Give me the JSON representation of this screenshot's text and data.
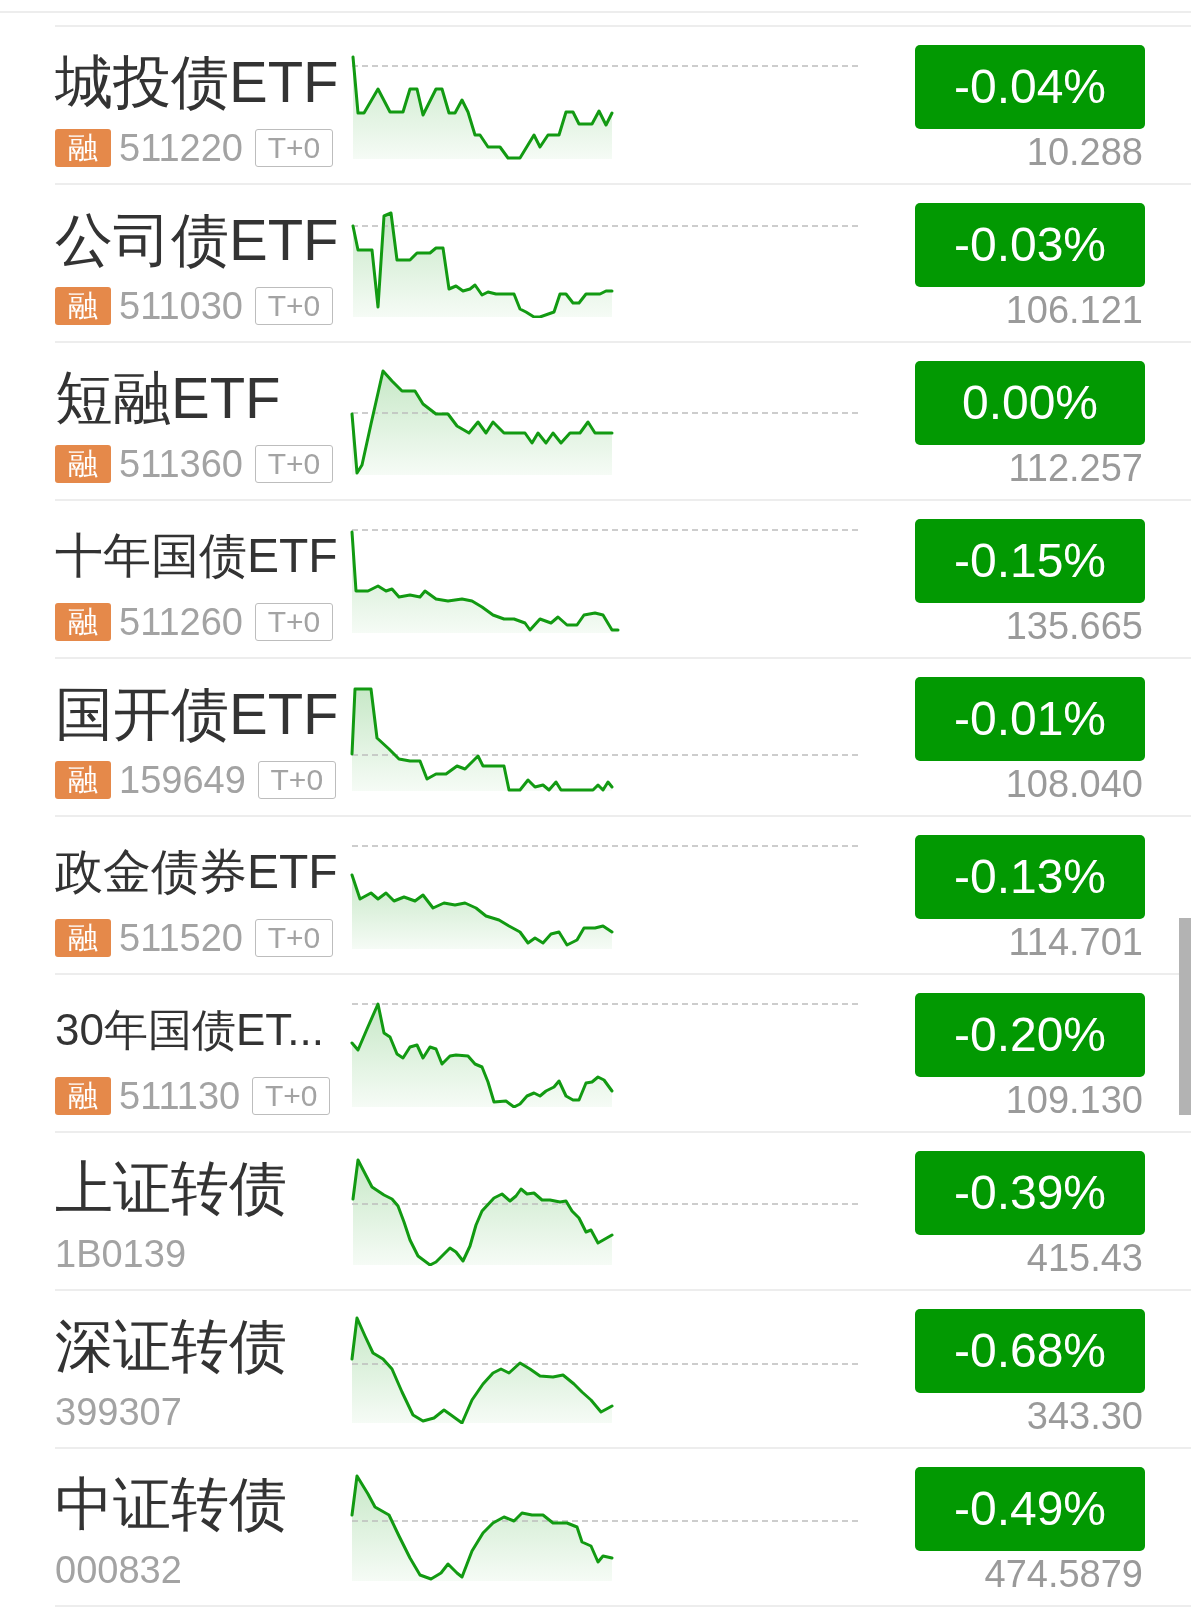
{
  "rows": [
    {
      "name": "城投债ETF",
      "margin_tag": "融",
      "code": "511220",
      "trading_tag": "T+0",
      "change": "-0.04%",
      "price": "10.288"
    },
    {
      "name": "公司债ETF",
      "margin_tag": "融",
      "code": "511030",
      "trading_tag": "T+0",
      "change": "-0.03%",
      "price": "106.121"
    },
    {
      "name": "短融ETF",
      "margin_tag": "融",
      "code": "511360",
      "trading_tag": "T+0",
      "change": "0.00%",
      "price": "112.257"
    },
    {
      "name": "十年国债ETF",
      "margin_tag": "融",
      "code": "511260",
      "trading_tag": "T+0",
      "change": "-0.15%",
      "price": "135.665"
    },
    {
      "name": "国开债ETF",
      "margin_tag": "融",
      "code": "159649",
      "trading_tag": "T+0",
      "change": "-0.01%",
      "price": "108.040"
    },
    {
      "name": "政金债券ETF",
      "margin_tag": "融",
      "code": "511520",
      "trading_tag": "T+0",
      "change": "-0.13%",
      "price": "114.701"
    },
    {
      "name": "30年国债ET...",
      "margin_tag": "融",
      "code": "511130",
      "trading_tag": "T+0",
      "change": "-0.20%",
      "price": "109.130"
    },
    {
      "name": "上证转债",
      "code": "1B0139",
      "change": "-0.39%",
      "price": "415.43"
    },
    {
      "name": "深证转债",
      "code": "399307",
      "change": "-0.68%",
      "price": "343.30"
    },
    {
      "name": "中证转债",
      "code": "000832",
      "change": "-0.49%",
      "price": "474.5879"
    }
  ]
}
